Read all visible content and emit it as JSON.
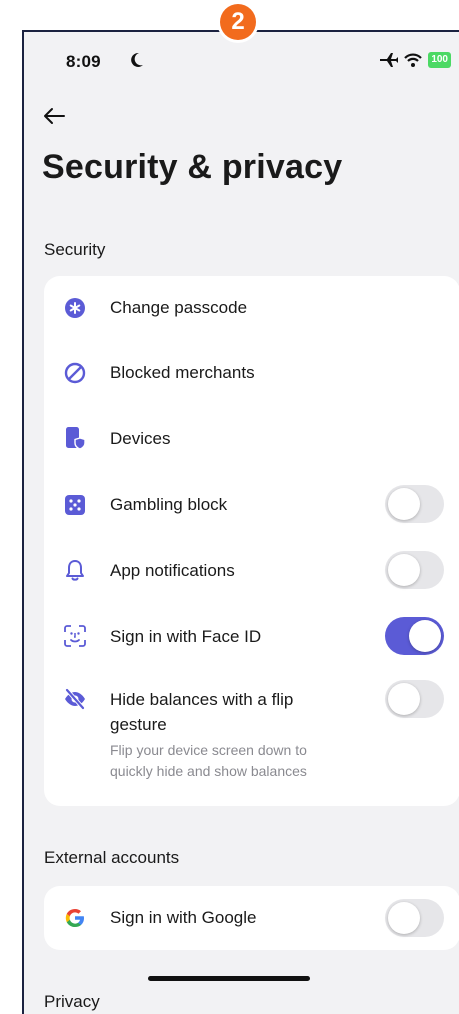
{
  "step_badge": "2",
  "status_bar": {
    "time": "8:09",
    "battery": "100"
  },
  "page_title": "Security & privacy",
  "sections": {
    "security": {
      "label": "Security",
      "items": [
        {
          "label": "Change passcode",
          "icon": "asterisk-icon"
        },
        {
          "label": "Blocked merchants",
          "icon": "blocked-icon"
        },
        {
          "label": "Devices",
          "icon": "device-shield-icon"
        },
        {
          "label": "Gambling block",
          "icon": "dice-icon",
          "toggle": false
        },
        {
          "label": "App notifications",
          "icon": "bell-icon",
          "toggle": false
        },
        {
          "label": "Sign in with Face ID",
          "icon": "face-id-icon",
          "toggle": true
        },
        {
          "label": "Hide balances with a flip gesture",
          "label_line1": "Hide balances with a flip",
          "label_line2": "gesture",
          "sublabel_line1": "Flip your device screen down to",
          "sublabel_line2": "quickly hide and show balances",
          "icon": "eye-slash-icon",
          "toggle": false
        }
      ]
    },
    "external": {
      "label": "External accounts",
      "items": [
        {
          "label": "Sign in with Google",
          "icon": "google-icon",
          "toggle": false
        }
      ]
    },
    "privacy": {
      "label": "Privacy"
    }
  },
  "colors": {
    "accent": "#5b5bd6",
    "badge": "#f26b1d",
    "toggle_off": "#e6e6e9"
  }
}
